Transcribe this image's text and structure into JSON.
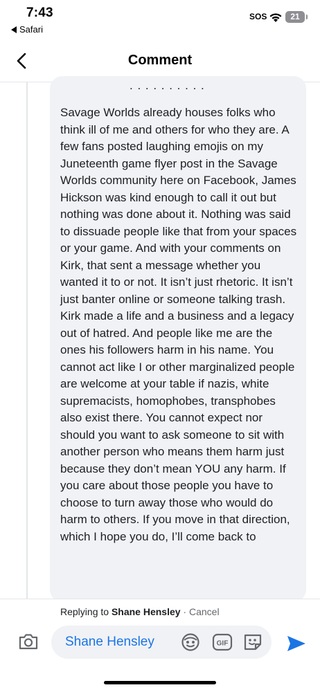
{
  "status": {
    "time": "7:43",
    "back_app": "Safari",
    "sos": "SOS",
    "battery": "21"
  },
  "nav": {
    "title": "Comment"
  },
  "comment": {
    "cut_line": ". . . . . . . . . ."
  },
  "comment_text": "Savage Worlds already houses folks who think ill of me and others for who they are. A few fans posted laughing emojis on my Juneteenth game flyer post in the Savage Worlds community here on Facebook, James Hickson was kind enough to call it out but nothing was done about it. Nothing was said to dissuade people like that from your spaces or your game. And with your comments on Kirk, that sent a message whether you wanted it to or not. It isn’t just rhetoric. It isn’t just banter online or someone talking trash. Kirk made a life and a business and a legacy out of hatred. And people like me are the ones his followers harm in his name. You cannot act like I or other marginalized people are welcome at your table if nazis, white supremacists, homophobes, transphobes also exist there. You cannot expect nor should you want to ask someone to sit with another person who means them harm just because they don’t mean YOU any harm. If you care about those people you have to choose to turn away those who would do harm to others. If you move in that direction, which I hope you do, I’ll come back to",
  "reply": {
    "replying_to": "Replying to",
    "name": "Shane Hensley",
    "separator": " · ",
    "cancel": "Cancel",
    "input_mention": "Shane Hensley"
  },
  "colors": {
    "accent": "#1b74e4",
    "bubble": "#f0f2f5",
    "text": "#1c1e21",
    "muted": "#65676b"
  },
  "icons": [
    "chevron-left-icon",
    "wifi-icon",
    "camera-icon",
    "emoji-icon",
    "gif-icon",
    "sticker-icon",
    "send-icon"
  ]
}
